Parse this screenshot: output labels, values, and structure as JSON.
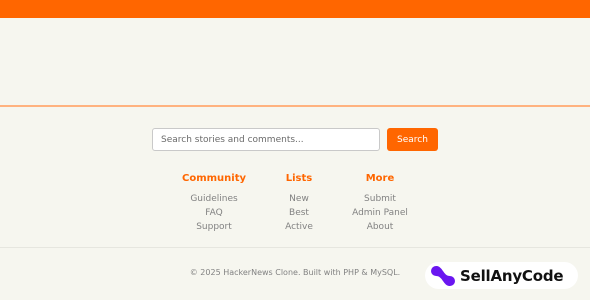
{
  "search": {
    "placeholder": "Search stories and comments...",
    "button_label": "Search"
  },
  "footer": {
    "columns": [
      {
        "heading": "Community",
        "links": [
          "Guidelines",
          "FAQ",
          "Support"
        ]
      },
      {
        "heading": "Lists",
        "links": [
          "New",
          "Best",
          "Active"
        ]
      },
      {
        "heading": "More",
        "links": [
          "Submit",
          "Admin Panel",
          "About"
        ]
      }
    ],
    "copyright": "© 2025 HackerNews Clone. Built with PHP & MySQL."
  },
  "brand": {
    "name": "SellAnyCode",
    "logo_icon": "sellanycode-logo-icon"
  },
  "colors": {
    "accent": "#ff6600",
    "background": "#f6f6ef",
    "muted_text": "#828282",
    "logo_purple": "#6a16f0"
  }
}
